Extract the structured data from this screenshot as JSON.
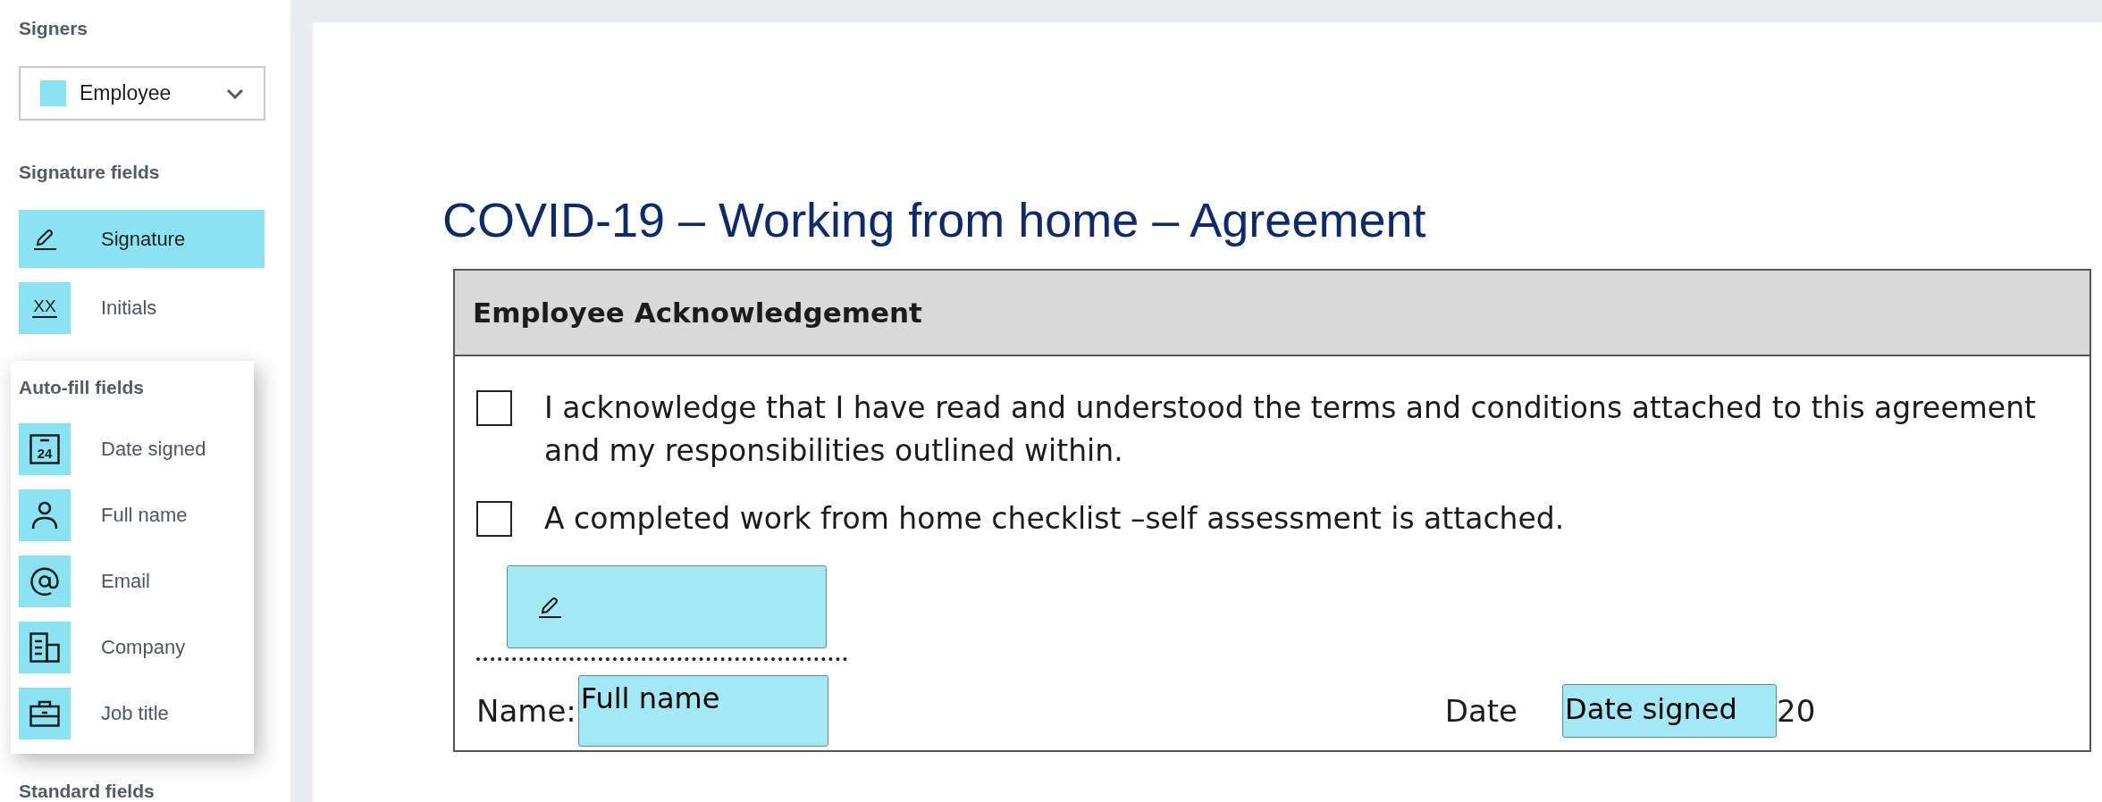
{
  "sidebar": {
    "signers": {
      "heading": "Signers",
      "signer": {
        "label": "Employee",
        "color": "#8ae3f3"
      }
    },
    "signature_fields": {
      "heading": "Signature fields",
      "items": [
        {
          "kind": "signature",
          "label": "Signature",
          "selected": true
        },
        {
          "kind": "initials",
          "label": "Initials",
          "icon_text": "XX",
          "selected": false
        }
      ]
    },
    "autofill_fields": {
      "heading": "Auto-fill fields",
      "items": [
        {
          "kind": "date",
          "label": "Date signed",
          "icon_text": "24"
        },
        {
          "kind": "person",
          "label": "Full name"
        },
        {
          "kind": "email",
          "label": "Email"
        },
        {
          "kind": "company",
          "label": "Company"
        },
        {
          "kind": "job",
          "label": "Job title"
        }
      ]
    },
    "standard_fields": {
      "heading": "Standard fields"
    }
  },
  "document": {
    "title": "COVID-19 – Working from home – Agreement",
    "section": {
      "heading": "Employee Acknowledgement",
      "items": [
        {
          "text": "I acknowledge that I have read and understood the terms and conditions attached to this agreement and my responsibilities outlined within.",
          "checked": false
        },
        {
          "text": "A completed work from home checklist –self assessment is attached.",
          "checked": false
        }
      ]
    },
    "name_label": "Name:",
    "name_field": "Full name",
    "date_label": "Date",
    "date_field": "Date signed",
    "date_suffix": "20"
  }
}
